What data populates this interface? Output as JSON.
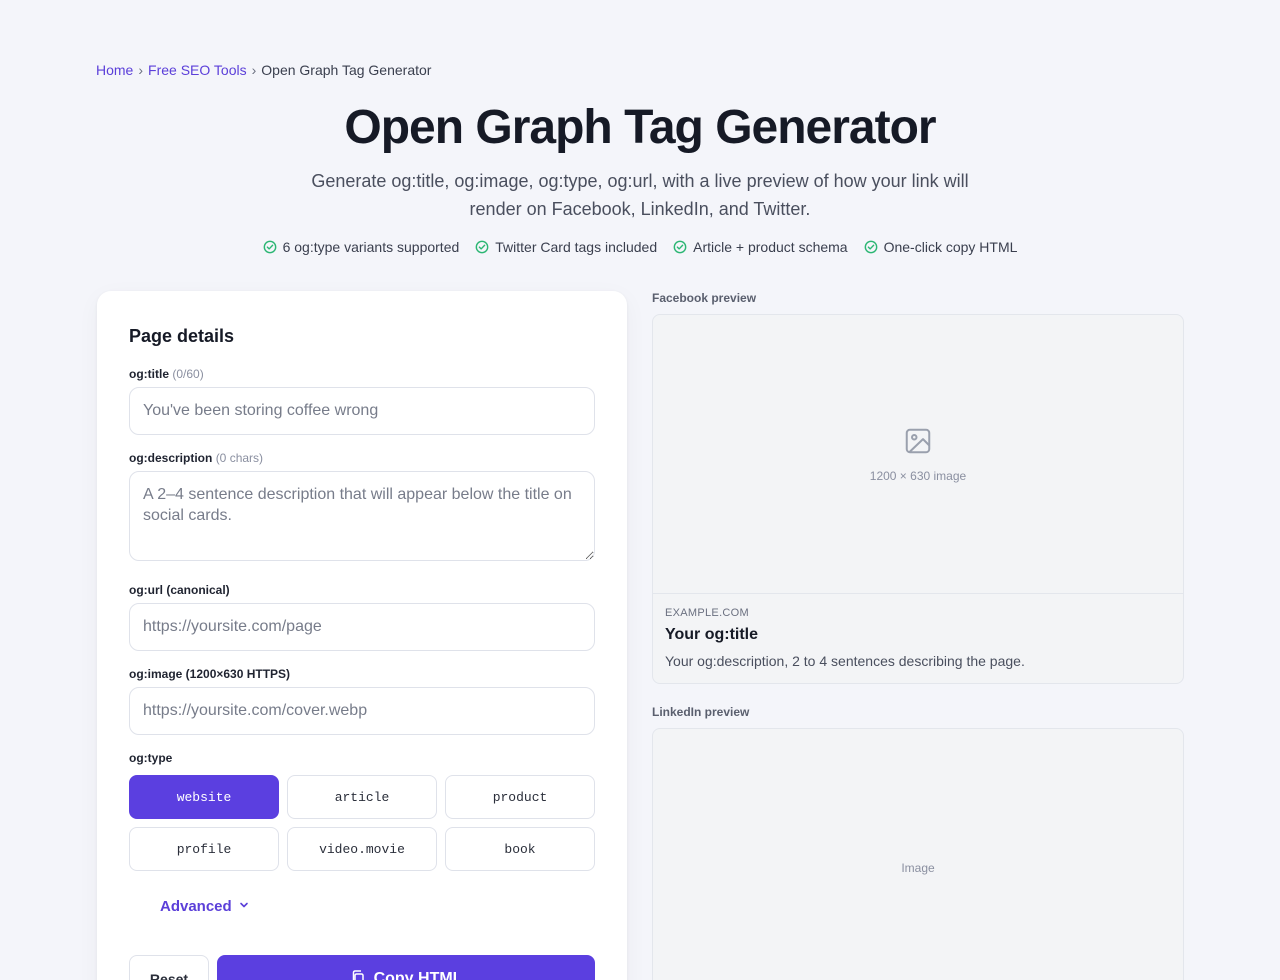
{
  "breadcrumb": {
    "home": "Home",
    "section": "Free SEO Tools",
    "current": "Open Graph Tag Generator",
    "separator": "›"
  },
  "hero": {
    "title": "Open Graph Tag Generator",
    "subtitle": "Generate og:title, og:image, og:type, og:url, with a live preview of how your link will render on Facebook, LinkedIn, and Twitter."
  },
  "features": [
    "6 og:type variants supported",
    "Twitter Card tags included",
    "Article + product schema",
    "One-click copy HTML"
  ],
  "form": {
    "heading": "Page details",
    "title_label": "og:title",
    "title_count": "(0/60)",
    "title_placeholder": "You've been storing coffee wrong",
    "title_value": "",
    "desc_label": "og:description",
    "desc_count": "(0 chars)",
    "desc_placeholder": "A 2–4 sentence description that will appear below the title on social cards.",
    "desc_value": "",
    "url_label": "og:url (canonical)",
    "url_placeholder": "https://yoursite.com/page",
    "url_value": "",
    "image_label": "og:image (1200×630 HTTPS)",
    "image_placeholder": "https://yoursite.com/cover.webp",
    "image_value": "",
    "type_label": "og:type",
    "types": [
      "website",
      "article",
      "product",
      "profile",
      "video.movie",
      "book"
    ],
    "selected_type": "website",
    "advanced_label": "Advanced",
    "reset_label": "Reset",
    "copy_label": "Copy HTML"
  },
  "facebook_preview": {
    "label": "Facebook preview",
    "image_caption": "1200 × 630 image",
    "domain": "EXAMPLE.COM",
    "title": "Your og:title",
    "description": "Your og:description, 2 to 4 sentences describing the page."
  },
  "linkedin_preview": {
    "label": "LinkedIn preview",
    "image_caption": "Image"
  },
  "colors": {
    "accent": "#5b3fe0",
    "link": "#5b3fd9",
    "check": "#2bb673",
    "background": "#f4f5fa"
  }
}
